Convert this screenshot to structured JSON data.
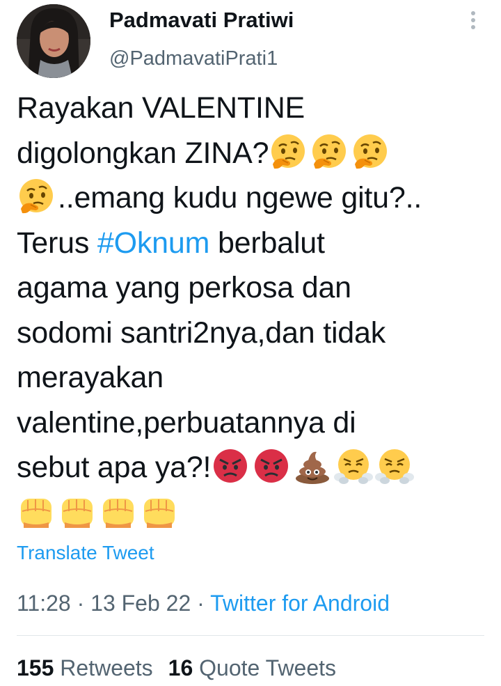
{
  "user": {
    "display_name": "Padmavati Pratiwi",
    "handle": "@PadmavatiPrati1"
  },
  "tweet": {
    "lines": [
      [
        {
          "t": "text",
          "v": "Rayakan VALENTINE"
        }
      ],
      [
        {
          "t": "text",
          "v": "digolongkan ZINA?"
        },
        {
          "t": "emoji",
          "v": "thinking"
        },
        {
          "t": "emoji",
          "v": "thinking"
        },
        {
          "t": "emoji",
          "v": "thinking"
        }
      ],
      [
        {
          "t": "emoji",
          "v": "thinking"
        },
        {
          "t": "text",
          "v": "..emang kudu ngewe gitu?.."
        }
      ],
      [
        {
          "t": "text",
          "v": "Terus "
        },
        {
          "t": "hashtag",
          "v": "#Oknum"
        },
        {
          "t": "text",
          "v": " berbalut"
        }
      ],
      [
        {
          "t": "text",
          "v": "agama yang perkosa dan"
        }
      ],
      [
        {
          "t": "text",
          "v": "sodomi santri2nya,dan tidak"
        }
      ],
      [
        {
          "t": "text",
          "v": "merayakan"
        }
      ],
      [
        {
          "t": "text",
          "v": "valentine,perbuatannya di"
        }
      ],
      [
        {
          "t": "text",
          "v": "sebut apa ya?!"
        },
        {
          "t": "emoji",
          "v": "angry"
        },
        {
          "t": "emoji",
          "v": "angry"
        },
        {
          "t": "emoji",
          "v": "poop"
        },
        {
          "t": "emoji",
          "v": "steam"
        },
        {
          "t": "emoji",
          "v": "steam"
        }
      ],
      [
        {
          "t": "emoji",
          "v": "fist"
        },
        {
          "t": "emoji",
          "v": "fist"
        },
        {
          "t": "emoji",
          "v": "fist"
        },
        {
          "t": "emoji",
          "v": "fist"
        }
      ]
    ],
    "translate_label": "Translate Tweet"
  },
  "meta": {
    "time": "11:28",
    "separator": " · ",
    "date": "13 Feb 22",
    "source": "Twitter for Android"
  },
  "stats": {
    "retweets_count": "155",
    "retweets_label": "Retweets",
    "quotes_count": "16",
    "quotes_label": "Quote Tweets"
  },
  "colors": {
    "link": "#1d9bf0",
    "secondary_text": "#536471",
    "primary_text": "#0f1419"
  }
}
